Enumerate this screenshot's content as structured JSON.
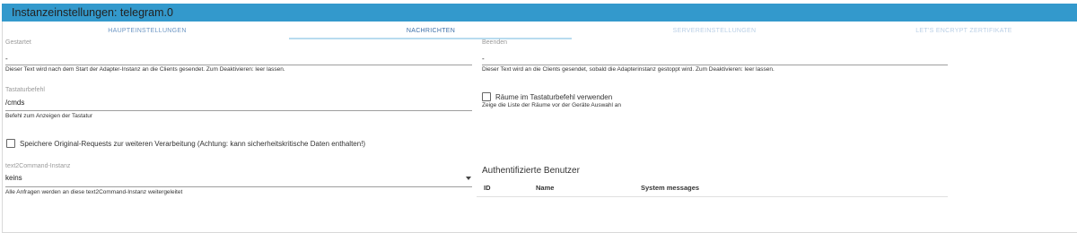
{
  "title": "Instanzeinstellungen: telegram.0",
  "tabs": [
    {
      "label": "HAUPTEINSTELLUNGEN"
    },
    {
      "label": "NACHRICHTEN"
    },
    {
      "label": "SERVEREINSTELLUNGEN"
    },
    {
      "label": "LET'S ENCRYPT ZERTIFIKATE"
    }
  ],
  "fields": {
    "started": {
      "label": "Gestartet",
      "value": "-",
      "help": "Dieser Text wird nach dem Start der Adapter-Instanz an die Clients gesendet. Zum Deaktivieren: leer lassen."
    },
    "stopped": {
      "label": "Beenden",
      "value": "-",
      "help": "Dieser Text wird an die Clients gesendet, sobald die Adapterinstanz gestoppt wird. Zum Deaktivieren: leer lassen."
    },
    "keyboard": {
      "label": "Tastaturbefehl",
      "value": "/cmds",
      "help": "Befehl zum Anzeigen der Tastatur"
    },
    "rooms": {
      "label": "Räume im Tastaturbefehl verwenden",
      "checked": false,
      "help": "Zeige die Liste der Räume vor der Geräte Auswahl an"
    },
    "store_raw": {
      "label": "Speichere Original-Requests zur weiteren Verarbeitung (Achtung: kann sicherheitskritische Daten enthalten!)",
      "checked": false
    },
    "text2command": {
      "label": "text2Command-Instanz",
      "value": "keins",
      "help": "Alle Anfragen werden an diese text2Command-Instanz weitergeleitet"
    }
  },
  "users": {
    "heading": "Authentifizierte Benutzer",
    "columns": [
      "ID",
      "Name",
      "System messages"
    ]
  }
}
